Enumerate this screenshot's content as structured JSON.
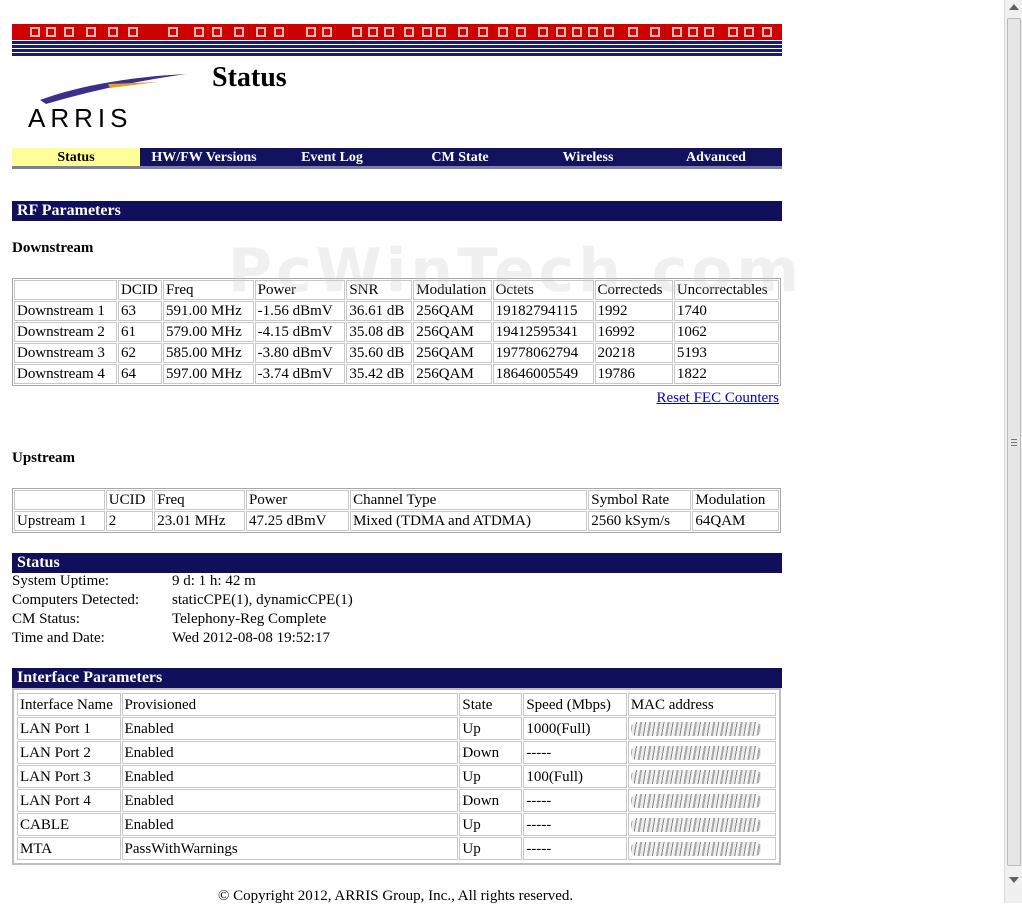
{
  "brand": {
    "logo_text": "ARRIS",
    "logo_color": "#3a2e8f",
    "accent_red": "#cc0000",
    "navy": "#0f0f5c"
  },
  "header": {
    "title": "Status"
  },
  "nav": {
    "tabs": [
      {
        "label": "Status",
        "active": true
      },
      {
        "label": "HW/FW Versions"
      },
      {
        "label": "Event Log"
      },
      {
        "label": "CM State"
      },
      {
        "label": "Wireless"
      },
      {
        "label": "Advanced"
      }
    ]
  },
  "rf": {
    "title": "RF Parameters",
    "downstream": {
      "title": "Downstream",
      "headers": [
        "",
        "DCID",
        "Freq",
        "Power",
        "SNR",
        "Modulation",
        "Octets",
        "Correcteds",
        "Uncorrectables"
      ],
      "rows": [
        [
          "Downstream 1",
          "63",
          "591.00 MHz",
          "-1.56 dBmV",
          "36.61 dB",
          "256QAM",
          "19182794115",
          "1992",
          "1740"
        ],
        [
          "Downstream 2",
          "61",
          "579.00 MHz",
          "-4.15 dBmV",
          "35.08 dB",
          "256QAM",
          "19412595341",
          "16992",
          "1062"
        ],
        [
          "Downstream 3",
          "62",
          "585.00 MHz",
          "-3.80 dBmV",
          "35.60 dB",
          "256QAM",
          "19778062794",
          "20218",
          "5193"
        ],
        [
          "Downstream 4",
          "64",
          "597.00 MHz",
          "-3.74 dBmV",
          "35.42 dB",
          "256QAM",
          "18646005549",
          "19786",
          "1822"
        ]
      ],
      "reset_link": "Reset FEC Counters"
    },
    "upstream": {
      "title": "Upstream",
      "headers": [
        "",
        "UCID",
        "Freq",
        "Power",
        "Channel Type",
        "Symbol Rate",
        "Modulation"
      ],
      "rows": [
        [
          "Upstream 1",
          "2",
          "23.01 MHz",
          "47.25 dBmV",
          "Mixed (TDMA and ATDMA)",
          "2560 kSym/s",
          "64QAM"
        ]
      ]
    }
  },
  "status": {
    "title": "Status",
    "items": [
      {
        "label": "System Uptime:",
        "value": "9 d: 1 h: 42 m"
      },
      {
        "label": "Computers Detected:",
        "value": "staticCPE(1), dynamicCPE(1)"
      },
      {
        "label": "CM Status:",
        "value": "Telephony-Reg Complete"
      },
      {
        "label": "Time and Date:",
        "value": "Wed 2012-08-08 19:52:17"
      }
    ]
  },
  "interface": {
    "title": "Interface Parameters",
    "headers": [
      "Interface Name",
      "Provisioned",
      "State",
      "Speed (Mbps)",
      "MAC address"
    ],
    "rows": [
      [
        "LAN Port 1",
        "Enabled",
        "Up",
        "1000(Full)"
      ],
      [
        "LAN Port 2",
        "Enabled",
        "Down",
        "-----"
      ],
      [
        "LAN Port 3",
        "Enabled",
        "Up",
        "100(Full)"
      ],
      [
        "LAN Port 4",
        "Enabled",
        "Down",
        "-----"
      ],
      [
        "CABLE",
        "Enabled",
        "Up",
        "-----"
      ],
      [
        "MTA",
        "PassWithWarnings",
        "Up",
        "-----"
      ]
    ]
  },
  "footer": {
    "copyright": "© Copyright 2012, ARRIS Group, Inc., All rights reserved."
  },
  "watermark": "PcWinTech.com"
}
